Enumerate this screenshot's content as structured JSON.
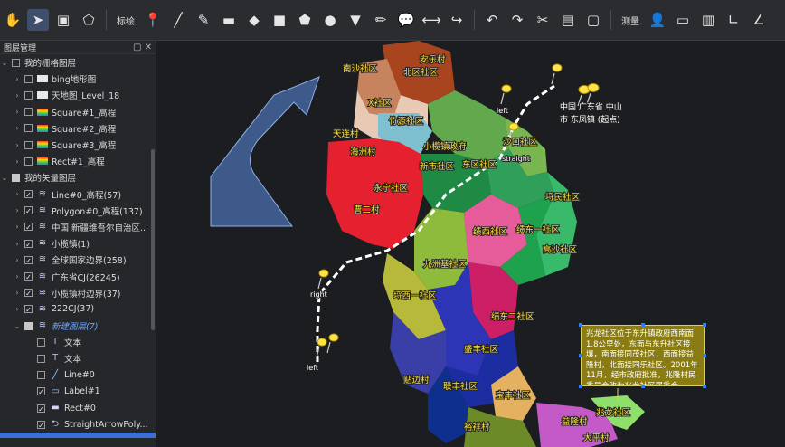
{
  "toolbar": {
    "draw_label": "标绘",
    "measure_label": "测量"
  },
  "panel": {
    "title": "图层管理",
    "raster_group": "我的栅格图层",
    "raster_layers": [
      "bing地形图",
      "天地图_Level_18",
      "Square#1_高程",
      "Square#2_高程",
      "Square#3_高程",
      "Rect#1_高程"
    ],
    "vector_group": "我的矢量图层",
    "vector_layers": [
      "Line#0_高程(57)",
      "Polygon#0_高程(137)",
      "中国 新疆维吾尔自治区...",
      "小榄镇(1)",
      "全球国家边界(258)",
      "广东省CJ(26245)",
      "小榄镇村边界(37)",
      "222CJ(37)"
    ],
    "new_layer": "新建图层(7)",
    "new_layer_items": [
      "文本",
      "文本",
      "Line#0",
      "Label#1",
      "Rect#0",
      "StraightArrowPoly..."
    ]
  },
  "map": {
    "region_labels": [
      "安乐村",
      "北区社区",
      "南沙社区",
      "X社区",
      "竹源社区",
      "小榄镇政府",
      "沙口社区",
      "天连村",
      "海洲村",
      "新市社区",
      "东区社区",
      "永宁社区",
      "曹二村",
      "埒民社区",
      "绩西社区",
      "绩东一社区",
      "高沙社区",
      "九洲基社区",
      "埒西一社区",
      "绩东二社区",
      "盛丰社区",
      "贴边村",
      "联丰社区",
      "宝丰社区",
      "裕祥村",
      "益隆村",
      "兆龙社区",
      "大平村"
    ],
    "route_labels": [
      "left",
      "straight",
      "right",
      "left"
    ],
    "origin_label_line1": "中国 广东省 中山",
    "origin_label_line2": "市 东凤镇 (起点)",
    "info_text": "兆龙社区位于东升镇政府西南面1.8公里处，东面与东升社区接壤，南面接同茂社区，西面接益隆村，北面接同乐社区。2001年11月，经市政府批准，兆隆村民委员会改为兆龙社区居委会。"
  }
}
